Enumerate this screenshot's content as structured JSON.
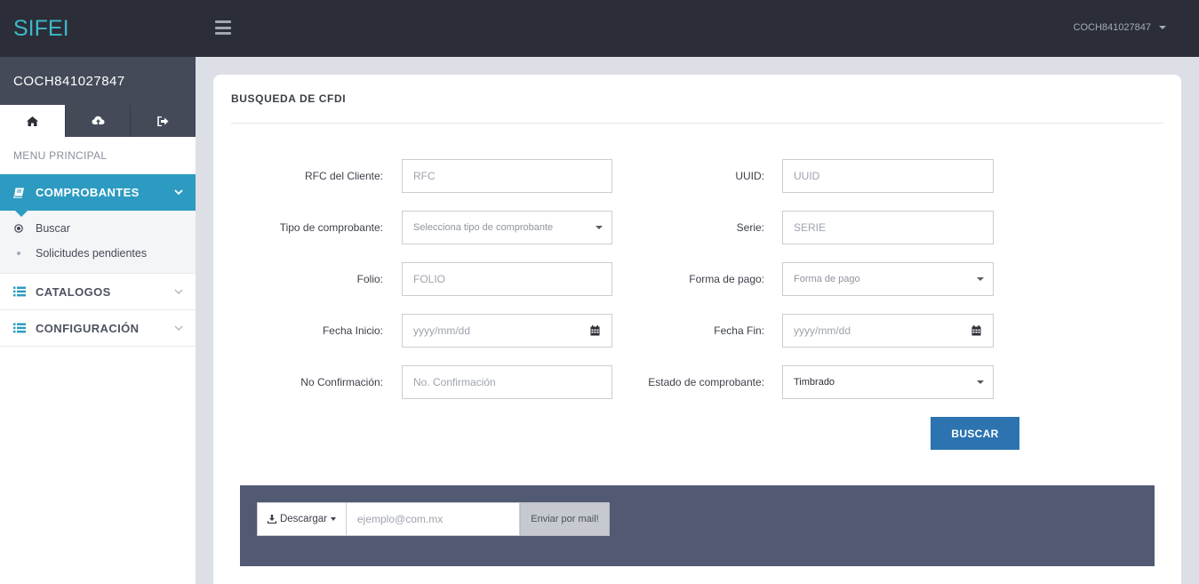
{
  "brand": {
    "name": "SIFEI",
    "color": "#3eb8c9"
  },
  "topbar": {
    "user": "COCH841027847"
  },
  "sidebar": {
    "user": "COCH841027847",
    "tabs": [
      {
        "icon": "home-icon"
      },
      {
        "icon": "cloud-upload-icon"
      },
      {
        "icon": "sign-out-icon"
      }
    ],
    "menu_heading": "MENU PRINCIPAL",
    "items": [
      {
        "label": "COMPROBANTES",
        "icon": "book-icon",
        "active": true,
        "children": [
          {
            "label": "Buscar",
            "selected": true
          },
          {
            "label": "Solicitudes pendientes",
            "selected": false
          }
        ]
      },
      {
        "label": "CATALOGOS",
        "icon": "list-icon"
      },
      {
        "label": "CONFIGURACIÓN",
        "icon": "list-icon"
      }
    ]
  },
  "panel": {
    "title": "BUSQUEDA DE CFDI",
    "fields": {
      "rfc": {
        "label": "RFC del Cliente:",
        "placeholder": "RFC"
      },
      "uuid": {
        "label": "UUID:",
        "placeholder": "UUID"
      },
      "tipo": {
        "label": "Tipo de comprobante:",
        "value": "Selecciona tipo de comprobante"
      },
      "serie": {
        "label": "Serie:",
        "placeholder": "SERIE"
      },
      "folio": {
        "label": "Folio:",
        "placeholder": "FOLIO"
      },
      "forma_pago": {
        "label": "Forma de pago:",
        "value": "Forma de pago"
      },
      "fecha_inicio": {
        "label": "Fecha Inicio:",
        "placeholder": "yyyy/mm/dd"
      },
      "fecha_fin": {
        "label": "Fecha Fin:",
        "placeholder": "yyyy/mm/dd"
      },
      "no_confirmacion": {
        "label": "No Confirmación:",
        "placeholder": "No. Confirmación"
      },
      "estado": {
        "label": "Estado de comprobante:",
        "value": "Timbrado"
      }
    },
    "buscar_label": "BUSCAR",
    "actions": {
      "descargar_label": "Descargar",
      "mail_placeholder": "ejemplo@com.mx",
      "enviar_label": "Enviar por mail!"
    }
  },
  "colors": {
    "accent": "#2d9bc1",
    "primary_button": "#2c73b0",
    "dark_bar": "#2b2e38",
    "action_bar": "#525a73"
  }
}
